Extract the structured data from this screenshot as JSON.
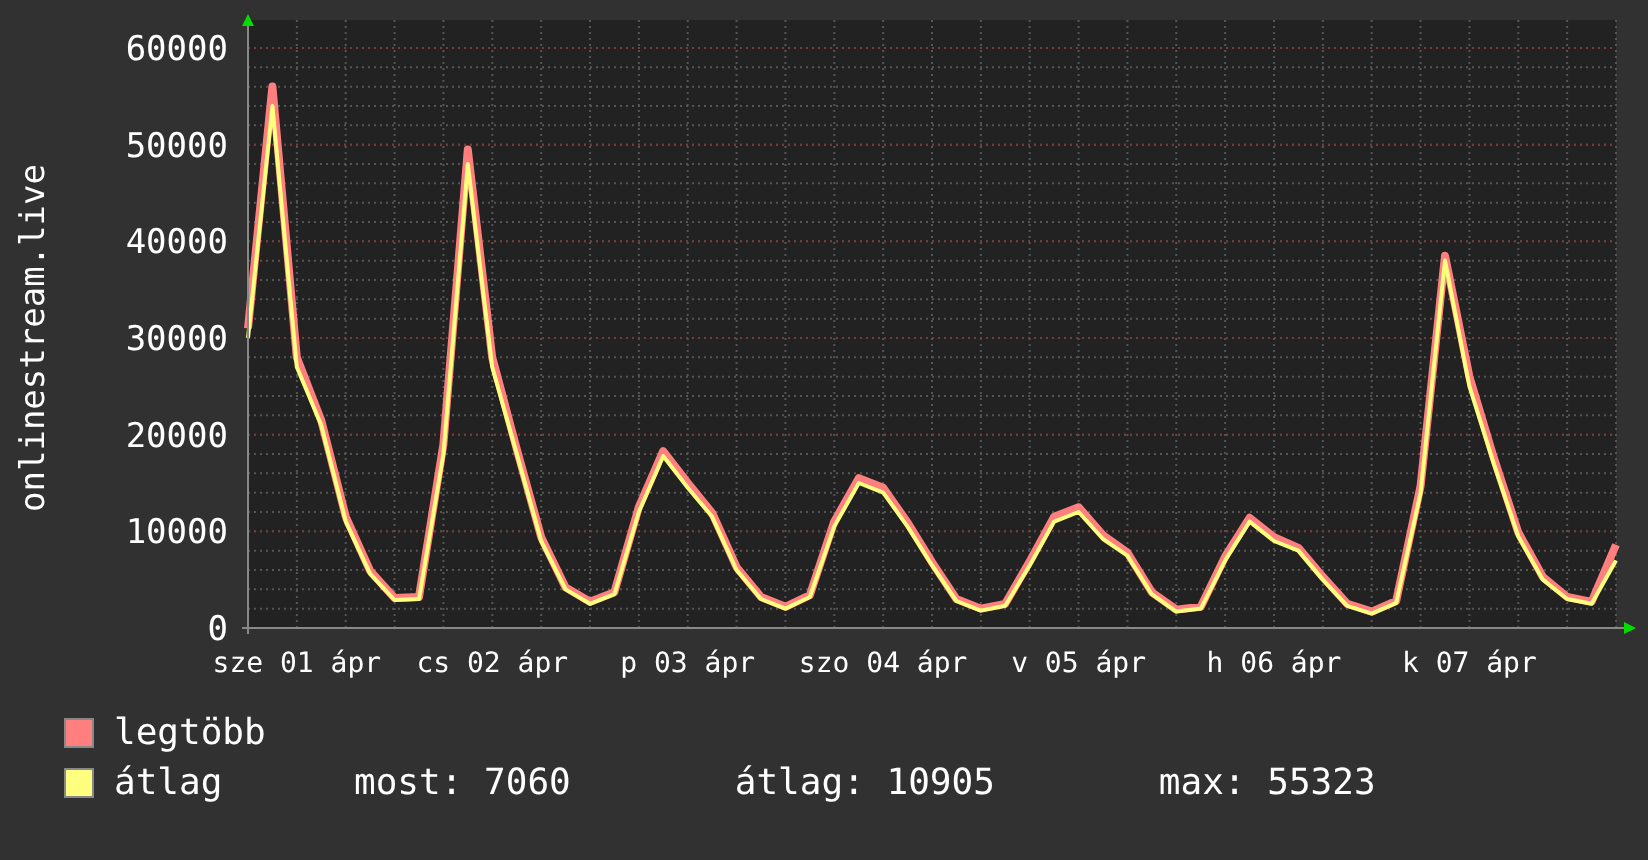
{
  "chart": {
    "chart_data": {
      "type": "line",
      "grid": true,
      "ylabel": "onlinestream.live",
      "ylim": [
        0,
        60000
      ],
      "yticks": [
        0,
        10000,
        20000,
        30000,
        40000,
        50000,
        60000
      ],
      "categories": [
        null,
        null,
        "sze 01 ápr",
        null,
        null,
        null,
        null,
        null,
        null,
        null,
        "cs 02 ápr",
        null,
        null,
        null,
        null,
        null,
        null,
        null,
        "p 03 ápr",
        null,
        null,
        null,
        null,
        null,
        null,
        null,
        "szo 04 ápr",
        null,
        null,
        null,
        null,
        null,
        null,
        null,
        "v 05 ápr",
        null,
        null,
        null,
        null,
        null,
        null,
        null,
        "h 06 ápr",
        null,
        null,
        null,
        null,
        null,
        null,
        null,
        "k 07 ápr",
        null,
        null,
        null,
        null,
        null,
        null
      ],
      "series": [
        {
          "name": "legtöbb",
          "color": "#ff7f7f",
          "values": [
            31000,
            56000,
            28000,
            21500,
            11500,
            5900,
            3100,
            3200,
            19000,
            49500,
            28000,
            18500,
            9400,
            4200,
            2700,
            3700,
            12500,
            18300,
            15000,
            11900,
            6300,
            3200,
            2200,
            3400,
            11000,
            15500,
            14500,
            10900,
            6800,
            3000,
            2000,
            2500,
            6900,
            11500,
            12500,
            9600,
            7800,
            3700,
            1900,
            2200,
            7400,
            11400,
            9400,
            8300,
            5300,
            2500,
            1700,
            2800,
            14700,
            38500,
            26000,
            17600,
            9900,
            5300,
            3200,
            2700,
            8600
          ]
        },
        {
          "name": "átlag",
          "color": "#ffff7f",
          "values": [
            30000,
            54000,
            27000,
            21000,
            11000,
            5600,
            2900,
            3000,
            18000,
            48000,
            27000,
            18000,
            9000,
            4000,
            2500,
            3500,
            12000,
            17800,
            14500,
            11500,
            6000,
            3000,
            2000,
            3200,
            10500,
            15000,
            14000,
            10500,
            6500,
            2800,
            1800,
            2300,
            6500,
            11000,
            12000,
            9200,
            7500,
            3500,
            1700,
            2000,
            7000,
            11000,
            9000,
            8000,
            5000,
            2300,
            1500,
            2600,
            14000,
            38000,
            25000,
            17000,
            9500,
            5000,
            3000,
            2500,
            7000
          ]
        }
      ]
    }
  },
  "legend": {
    "stats": [
      "most: 7060",
      "átlag: 10905",
      "max: 55323"
    ]
  }
}
